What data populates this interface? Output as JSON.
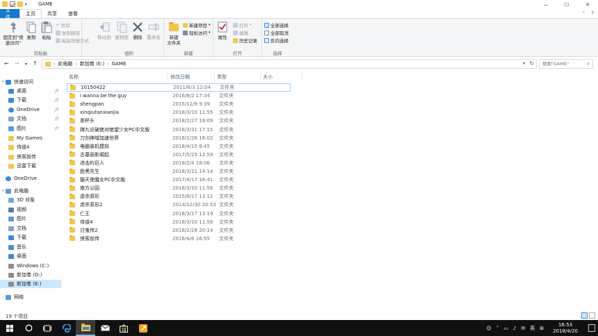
{
  "window": {
    "title": "GAME",
    "minimize": "—",
    "maximize": "☐",
    "close": "✕"
  },
  "tabs": {
    "file": "文件",
    "home": "主页",
    "share": "共享",
    "view": "查看"
  },
  "ribbon": {
    "clipboard": {
      "label": "剪贴板",
      "pin": "固定到\"快速访问\"",
      "copy": "复制",
      "paste": "粘贴",
      "cut": "剪切",
      "copy_path": "复制路径",
      "paste_shortcut": "粘贴快捷方式"
    },
    "organize": {
      "label": "组织",
      "move_to": "移动到",
      "copy_to": "复制到",
      "delete": "删除",
      "rename": "重命名"
    },
    "new": {
      "label": "新建",
      "new_folder": "新建\n文件夹",
      "new_item": "新建项目",
      "easy_access": "轻松访问"
    },
    "open": {
      "label": "打开",
      "properties": "属性",
      "open": "打开",
      "edit": "编辑",
      "history": "历史记录"
    },
    "select": {
      "label": "选择",
      "select_all": "全部选择",
      "select_none": "全部取消",
      "invert": "反向选择"
    }
  },
  "address": {
    "crumbs": [
      "此电脑",
      "新加卷 (E:)",
      "GAME"
    ],
    "search_placeholder": "搜索\"GAME\""
  },
  "nav_pane": {
    "quick_access": "快速访问",
    "quick_items": [
      "桌面",
      "下载",
      "OneDrive",
      "文档",
      "图片",
      "My Games",
      "侍道4",
      "侠客前传",
      "迅雷下载"
    ],
    "onedrive": "OneDrive",
    "this_pc": "此电脑",
    "pc_items": [
      "3D 对象",
      "视频",
      "图片",
      "文档",
      "下载",
      "音乐",
      "桌面",
      "Windows (C:)",
      "新加卷 (D:)",
      "新加卷 (E:)"
    ],
    "network": "网络"
  },
  "columns": {
    "name": "名称",
    "modified": "修改日期",
    "type": "类型",
    "size": "大小"
  },
  "files": [
    {
      "name": "10150422",
      "date": "2011/6/3 12:04",
      "type": "文件夹"
    },
    {
      "name": "i wanna be the guy",
      "date": "2016/8/2 17:34",
      "type": "文件夹"
    },
    {
      "name": "shengpan",
      "date": "2015/12/9 9:39",
      "type": "文件夹"
    },
    {
      "name": "xinqiutanxianjia",
      "date": "2018/3/10 11:55",
      "type": "文件夹"
    },
    {
      "name": "茶杯头",
      "date": "2018/2/27 18:09",
      "type": "文件夹"
    },
    {
      "name": "蹲九论破绝对绝望少女PC中文版",
      "date": "2018/3/31 17:15",
      "type": "文件夹"
    },
    {
      "name": "刀剑神域加速世界",
      "date": "2018/1/26 16:02",
      "type": "文件夹"
    },
    {
      "name": "电脑装机模拟",
      "date": "2018/4/15 8:45",
      "type": "文件夹"
    },
    {
      "name": "古墓丽影崛起",
      "date": "2017/5/25 12:59",
      "type": "文件夹"
    },
    {
      "name": "进击的巨人",
      "date": "2018/2/4 18:06",
      "type": "文件夹"
    },
    {
      "name": "脸黑先生",
      "date": "2018/3/11 14:14",
      "type": "文件夹"
    },
    {
      "name": "猫天使魔女PC中文版",
      "date": "2017/4/17 16:41",
      "type": "文件夹"
    },
    {
      "name": "南方公园",
      "date": "2018/3/10 11:56",
      "type": "文件夹"
    },
    {
      "name": "虐杀原形",
      "date": "2015/6/17 13:11",
      "type": "文件夹"
    },
    {
      "name": "虐杀原形2",
      "date": "2014/12/30 20:53",
      "type": "文件夹"
    },
    {
      "name": "仁王",
      "date": "2018/3/17 13:19",
      "type": "文件夹"
    },
    {
      "name": "侍道4",
      "date": "2018/3/10 11:56",
      "type": "文件夹"
    },
    {
      "name": "讨鬼传2",
      "date": "2018/2/28 20:14",
      "type": "文件夹"
    },
    {
      "name": "侠客前传",
      "date": "2018/4/6 16:55",
      "type": "文件夹"
    }
  ],
  "status": {
    "count": "19 个项目"
  },
  "taskbar": {
    "clock_time": "16:53",
    "clock_date": "2018/4/20",
    "ime": "英"
  },
  "colors": {
    "file_tab": "#1979ca",
    "selection": "#cce8ff",
    "folder": "#f3c64d",
    "taskbar": "#101010"
  }
}
